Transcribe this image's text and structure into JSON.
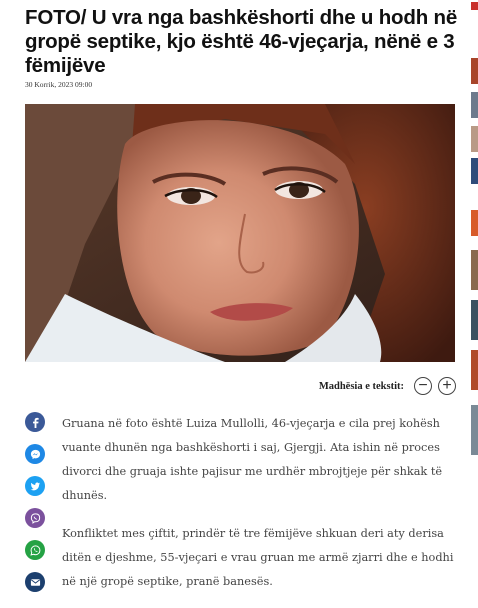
{
  "article": {
    "headline": "FOTO/ U vra nga bashkëshorti dhe u hodh në gropë septike, kjo është 46-vjeçarja, nënë e 3 fëmijëve",
    "date": "30 Korrik, 2023 09:00",
    "paragraphs": [
      "Gruana në foto është Luiza Mullolli, 46-vjeçarja e cila prej kohësh vuante dhunën nga bashkëshorti i saj, Gjergji. Ata ishin në proces divorci dhe gruaja ishte pajisur me urdhër mbrojtjeje për shkak të dhunës.",
      "Konfliktet mes çiftit, prindër të tre fëmijëve shkuan deri aty derisa ditën e djeshme, 55-vjeçari e vrau gruan me armë zjarri dhe e hodhi në një gropë septike, pranë banesës."
    ]
  },
  "text_size": {
    "label": "Madhësia e tekstit:",
    "decrease_symbol": "−",
    "increase_symbol": "+"
  },
  "share_buttons": [
    {
      "icon": "facebook-icon",
      "color": "#3b5998"
    },
    {
      "icon": "messenger-icon",
      "color": "#1e88e5"
    },
    {
      "icon": "twitter-icon",
      "color": "#1da1f2"
    },
    {
      "icon": "viber-icon",
      "color": "#7b519d"
    },
    {
      "icon": "whatsapp-icon",
      "color": "#25a244"
    },
    {
      "icon": "email-icon",
      "color": "#1c3f6e"
    }
  ],
  "sidebar_thumbnails": [
    "#c9302c",
    "#a8452a",
    "#6d7a8c",
    "#b99a86",
    "#2f4c7a",
    "#d85b2a",
    "#8a6a4e",
    "#3b5060",
    "#b04a2a",
    "#7a8a96"
  ]
}
